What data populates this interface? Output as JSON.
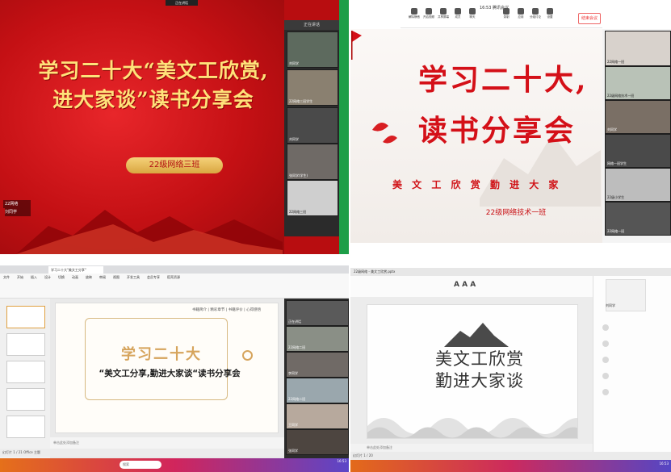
{
  "q1": {
    "topbar": "正在讲话",
    "title_line1": "学习二十大“美文工欣赏,",
    "title_line2": "进大家谈”读书分享会",
    "class_label": "22级网络三班",
    "self_view": "22网络",
    "self_view2": "刘同学",
    "gallery_header": "正在讲话",
    "participants": [
      "刘同学",
      "22网络三班学生",
      "刘同学",
      "张同学(学生)",
      "22网络三班"
    ]
  },
  "q2": {
    "meeting": "16:53  腾讯会议",
    "toolbar": [
      "解除静音",
      "开启视频",
      "共享屏幕",
      "成员",
      "聊天",
      "录制",
      "应用",
      "分组讨论",
      "设置"
    ],
    "leave": "结束会议",
    "title_line1": "学习二十大,",
    "title_line2": "读书分享会",
    "subtitle": "美 文 工 欣 赏   勤 进 大 家",
    "class_label": "22级网络技术一班",
    "participants": [
      "22网络一班",
      "22级网络技术一班",
      "刘同学",
      "网络一班学生",
      "22级小学生",
      "22网络一班"
    ]
  },
  "q3": {
    "tab": "学习二十大\"美文工分享\"",
    "menu": [
      "文件",
      "开始",
      "插入",
      "设计",
      "切换",
      "动画",
      "放映",
      "审阅",
      "视图",
      "开发工具",
      "会员专享",
      "稻壳资源"
    ],
    "nav": "书籍简介 | 精彩章节 | 书籍评价 | 心得感悟",
    "title": "学习二十大",
    "subtitle": "“美文工分享,勤进大家谈“读书分享会",
    "notes": "单击此处添加备注",
    "status": "幻灯片 1 / 21   Office 主题",
    "search": "搜索",
    "time": "16:53",
    "participants": [
      "正在讲话",
      "22网络二班",
      "李同学",
      "22网络二班",
      "王同学",
      "张同学"
    ]
  },
  "q4": {
    "topbar": "22级网络 - 美文工欣赏.pptx",
    "title_line1": "美文工欣赏",
    "title_line2": "勤进大家谈",
    "notes": "单击此处添加备注",
    "status": "幻灯片 1 / 20",
    "camera_name": "刘同学",
    "time": "16:53"
  },
  "colors": {
    "q1_bg": "#c41014",
    "q1_title": "#ffe27a",
    "q2_title": "#d41018",
    "q3_gold": "#d6a45c"
  }
}
